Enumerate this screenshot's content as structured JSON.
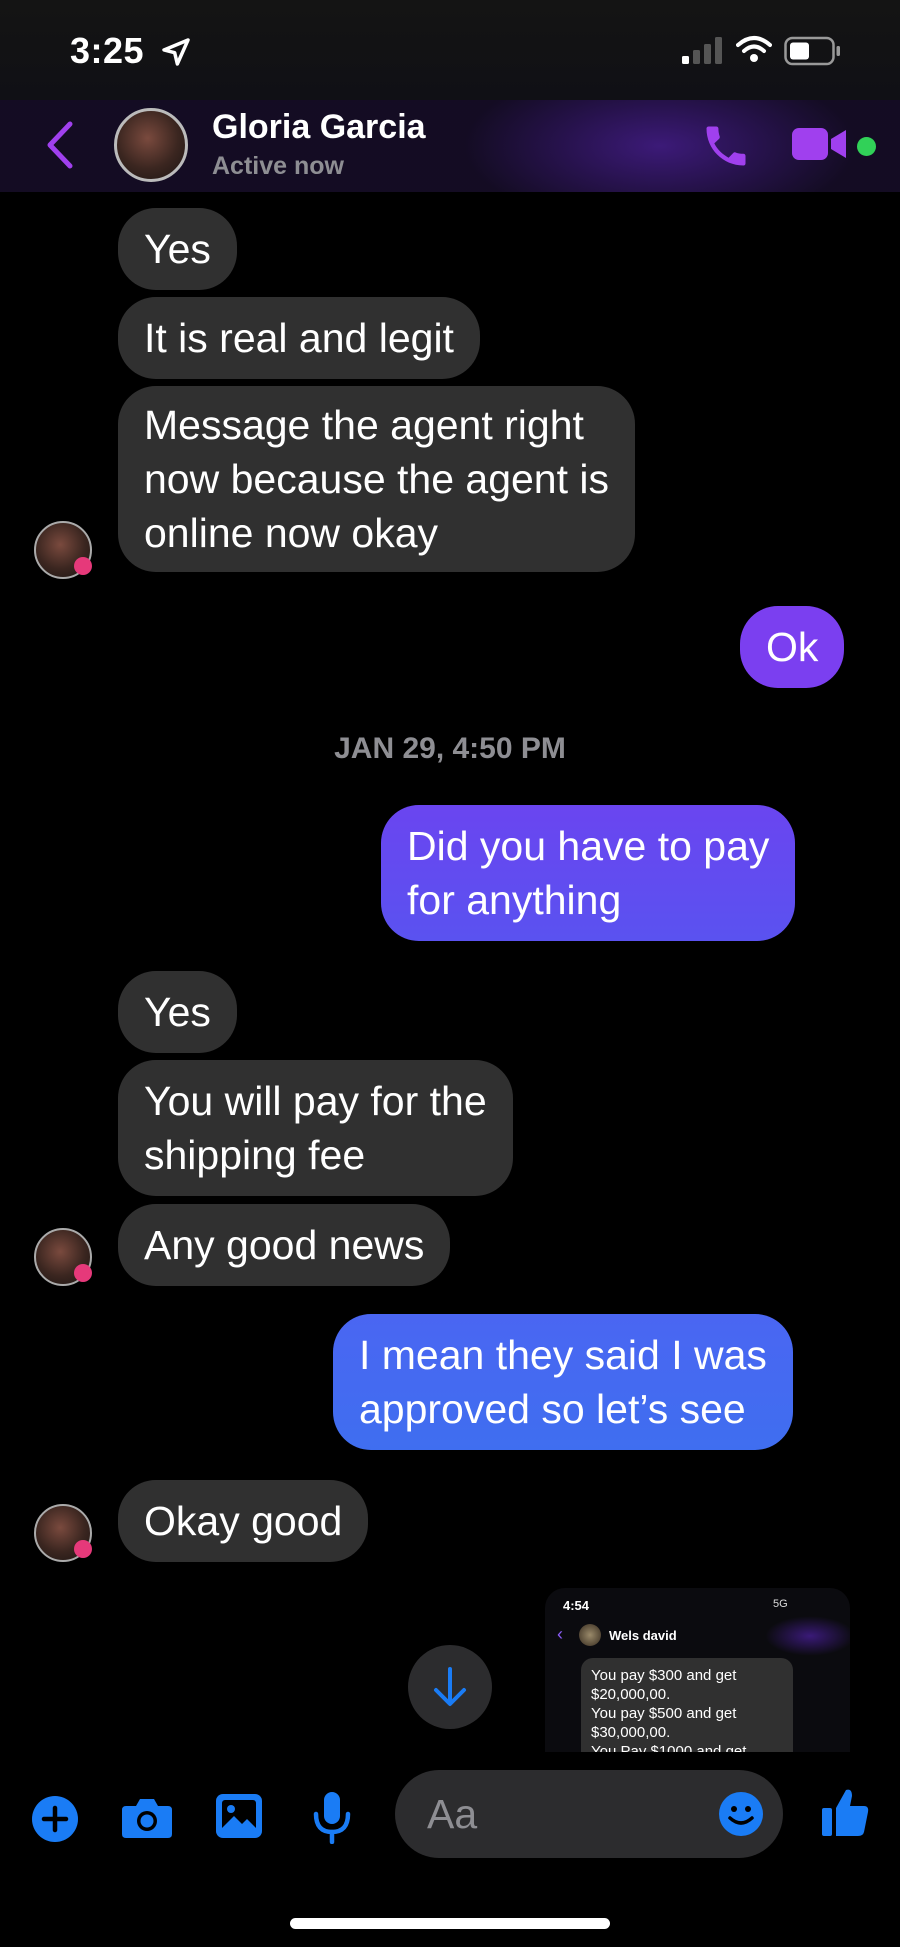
{
  "status_bar": {
    "time": "3:25"
  },
  "header": {
    "name": "Gloria Garcia",
    "status": "Active now"
  },
  "date_separator": "JAN 29, 4:50 PM",
  "messages": [
    {
      "from": "them",
      "text": "Yes"
    },
    {
      "from": "them",
      "text": "It is real and legit"
    },
    {
      "from": "them",
      "lines": [
        "Message the agent right",
        "now because the agent is",
        "online now okay"
      ]
    },
    {
      "from": "me",
      "text": "Ok"
    },
    {
      "from": "me",
      "lines": [
        "Did you have to pay",
        "for anything"
      ]
    },
    {
      "from": "them",
      "text": "Yes"
    },
    {
      "from": "them",
      "lines": [
        "You will pay for the",
        "shipping fee"
      ]
    },
    {
      "from": "them",
      "text": "Any good news"
    },
    {
      "from": "me",
      "lines": [
        "I mean they said I was",
        "approved so let’s see"
      ]
    },
    {
      "from": "them",
      "text": "Okay good"
    }
  ],
  "shared_screenshot": {
    "time": "4:54",
    "network": "5G",
    "name": "Wels david",
    "text": "You pay $300 and get\n$20,000,00.\nYou pay $500 and get\n$30,000,00.\nYou Pay $1000 and get"
  },
  "composer": {
    "placeholder": "Aa"
  },
  "colors": {
    "accent": "#a040ee",
    "incoming_bubble": "#303030",
    "outgoing_gradient": [
      "#7b3ff0",
      "#3f6ef0"
    ],
    "active_dot": "#31d158",
    "composer_icons": "#1a7cf5"
  },
  "icons": [
    "location-arrow-icon",
    "signal-icon",
    "wifi-icon",
    "battery-icon",
    "back-chevron-icon",
    "phone-icon",
    "video-camera-icon",
    "plus-icon",
    "camera-icon",
    "gallery-icon",
    "microphone-icon",
    "emoji-icon",
    "thumbs-up-icon",
    "arrow-down-icon"
  ]
}
